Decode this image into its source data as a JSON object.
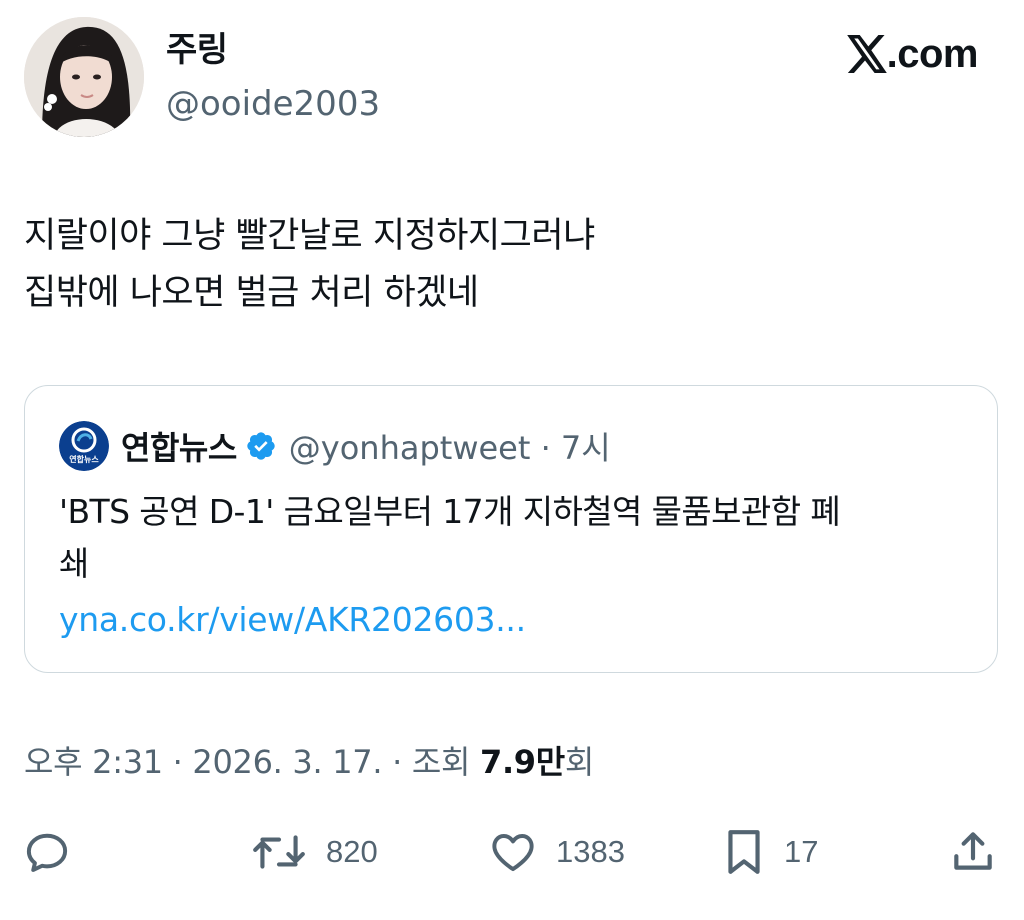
{
  "author": {
    "display_name": "주링",
    "handle": "@ooide2003"
  },
  "brand": {
    "domain": ".com",
    "logo_icon": "x-logo-icon"
  },
  "tweet": {
    "text_lines": [
      "지랄이야 그냥 빨간날로 지정하지그러냐",
      "집밖에 나오면 벌금 처리 하겠네"
    ]
  },
  "quoted": {
    "name": "연합뉴스",
    "meta": "@yonhaptweet · 7시",
    "logo_text": "연합뉴스",
    "text_lines": [
      "'BTS 공연 D-1' 금요일부터 17개 지하철역 물품보관함 폐",
      "쇄"
    ],
    "link": "yna.co.kr/view/AKR202603..."
  },
  "timestamp": {
    "prefix": "오후 2:31 · 2026. 3. 17. · 조회 ",
    "views_count": "7.9만",
    "views_suffix": "회"
  },
  "actions": {
    "retweets": "820",
    "likes": "1383",
    "bookmarks": "17"
  },
  "colors": {
    "text_primary": "#0f1419",
    "text_secondary": "#536471",
    "link": "#1d9bf0",
    "verified": "#1d9bf0",
    "border": "#cfd9de"
  }
}
